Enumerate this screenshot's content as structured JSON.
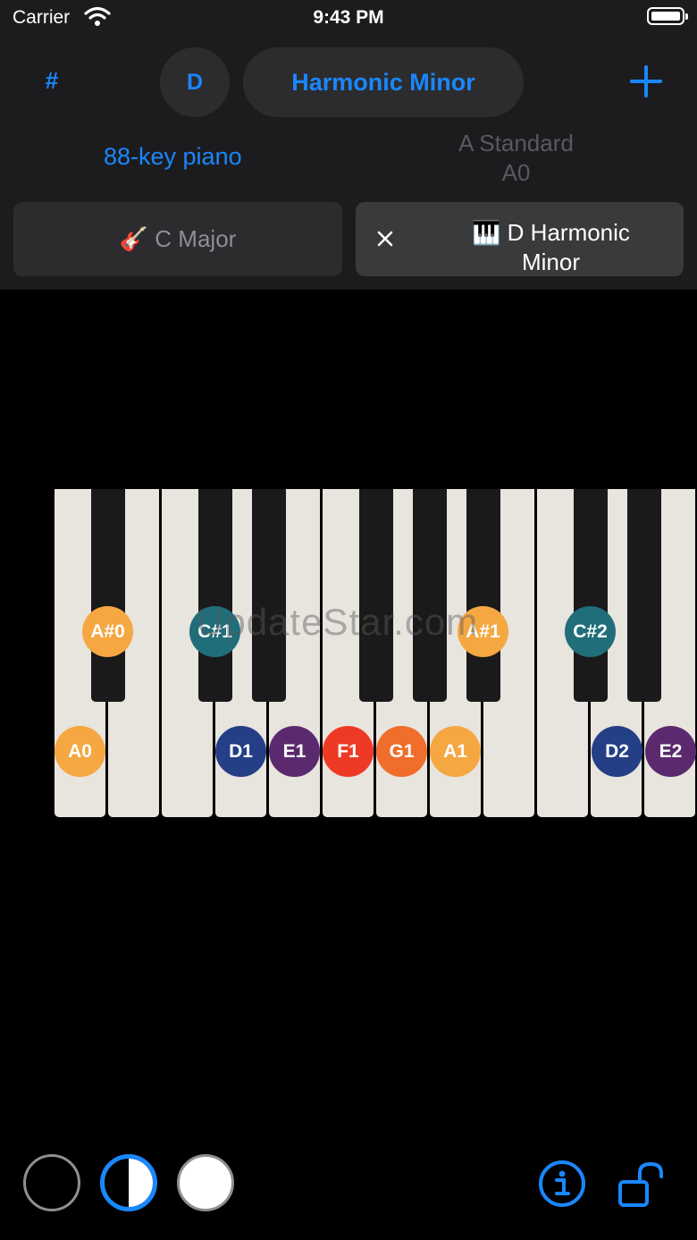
{
  "status_bar": {
    "carrier": "Carrier",
    "time": "9:43 PM"
  },
  "toolbar": {
    "sharp_label": "#",
    "key_label": "D",
    "scale_label": "Harmonic Minor"
  },
  "instrument_label": "88-key piano",
  "tuning": {
    "name": "A Standard",
    "start": "A0"
  },
  "layers": [
    {
      "icon": "🎸",
      "label": "C Major"
    },
    {
      "icon": "🎹",
      "line1": "D Harmonic",
      "line2": "Minor"
    }
  ],
  "watermark": "UpdateStar.com",
  "piano": {
    "notes": [
      {
        "label": "A#0",
        "color": "#f5a742"
      },
      {
        "label": "C#1",
        "color": "#1f6e7a"
      },
      {
        "label": "A#1",
        "color": "#f5a742"
      },
      {
        "label": "C#2",
        "color": "#1f6e7a"
      },
      {
        "label": "A0",
        "color": "#f5a742"
      },
      {
        "label": "D1",
        "color": "#243f86"
      },
      {
        "label": "E1",
        "color": "#5b2a6e"
      },
      {
        "label": "F1",
        "color": "#ee3a24"
      },
      {
        "label": "G1",
        "color": "#f06d2c"
      },
      {
        "label": "A1",
        "color": "#f5a742"
      },
      {
        "label": "D2",
        "color": "#243f86"
      },
      {
        "label": "E2",
        "color": "#5b2a6e"
      }
    ]
  },
  "colors": {
    "accent": "#1a87ff",
    "panel": "#1c1c1e",
    "button": "#2c2c2e"
  }
}
